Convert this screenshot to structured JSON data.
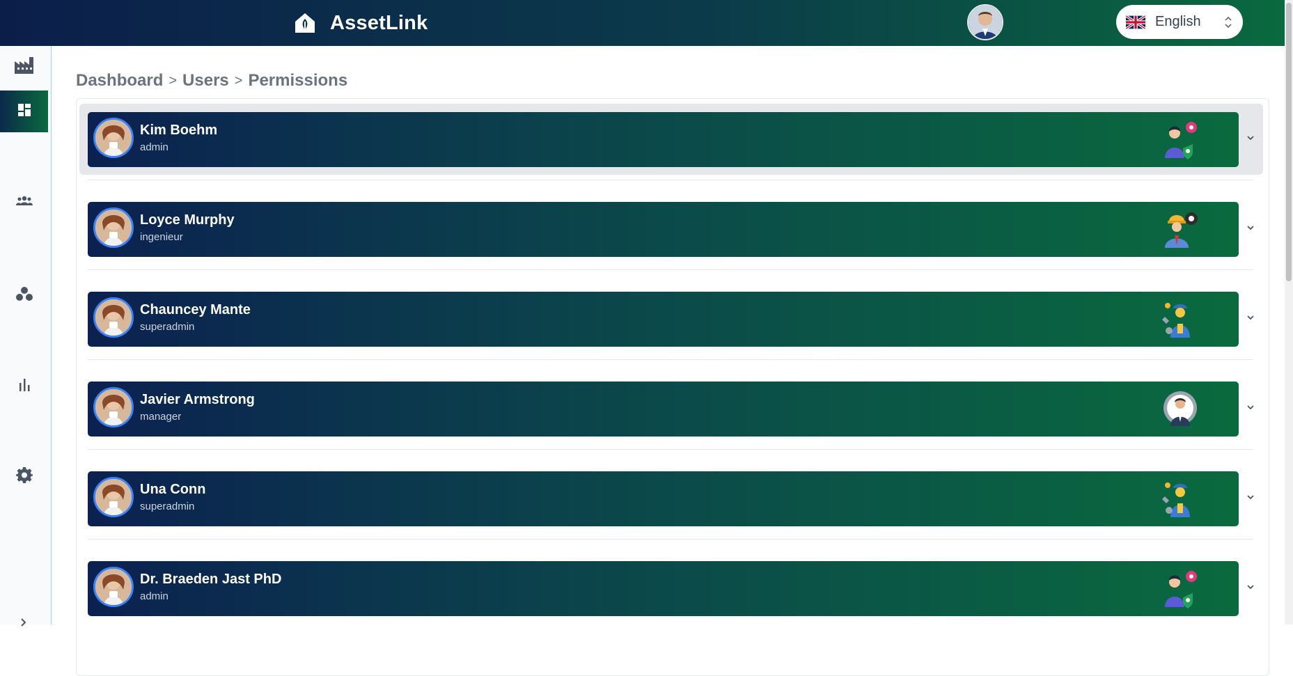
{
  "app": {
    "name": "AssetLink",
    "colors": {
      "header_start": "#0b1e4a",
      "header_end": "#0a6a3e",
      "row_bar_start": "#0b2150",
      "row_bar_end": "#0a6a3e",
      "avatar_ring": "#3b82f6"
    }
  },
  "header": {
    "logo_icon": "home-leaf-icon",
    "user_avatar": "avatar",
    "language": {
      "label": "English",
      "flag_icon": "uk-flag-icon",
      "toggle_icon": "chevron-updown-icon"
    }
  },
  "sidebar": {
    "items": [
      {
        "name": "factory",
        "icon": "factory-icon",
        "active": false
      },
      {
        "name": "dashboard",
        "icon": "dashboard-icon",
        "active": true
      },
      {
        "name": "users",
        "icon": "users-icon",
        "active": false
      },
      {
        "name": "groups",
        "icon": "groups-icon",
        "active": false
      },
      {
        "name": "reports",
        "icon": "bar-chart-icon",
        "active": false
      },
      {
        "name": "settings",
        "icon": "gear-icon",
        "active": false
      }
    ],
    "expander_icon": "chevron-right-icon"
  },
  "breadcrumb": {
    "items": [
      "Dashboard",
      "Users",
      "Permissions"
    ],
    "separator": ">"
  },
  "users": [
    {
      "name": "Kim Boehm",
      "role": "admin",
      "role_icon": "admin-role-icon",
      "highlighted": true
    },
    {
      "name": "Loyce Murphy",
      "role": "ingenieur",
      "role_icon": "engineer-role-icon",
      "highlighted": false
    },
    {
      "name": "Chauncey Mante",
      "role": "superadmin",
      "role_icon": "superadmin-role-icon",
      "highlighted": false
    },
    {
      "name": "Javier Armstrong",
      "role": "manager",
      "role_icon": "manager-role-icon",
      "highlighted": false
    },
    {
      "name": "Una Conn",
      "role": "superadmin",
      "role_icon": "superadmin-role-icon",
      "highlighted": false
    },
    {
      "name": "Dr. Braeden Jast PhD",
      "role": "admin",
      "role_icon": "admin-role-icon",
      "highlighted": false
    }
  ]
}
